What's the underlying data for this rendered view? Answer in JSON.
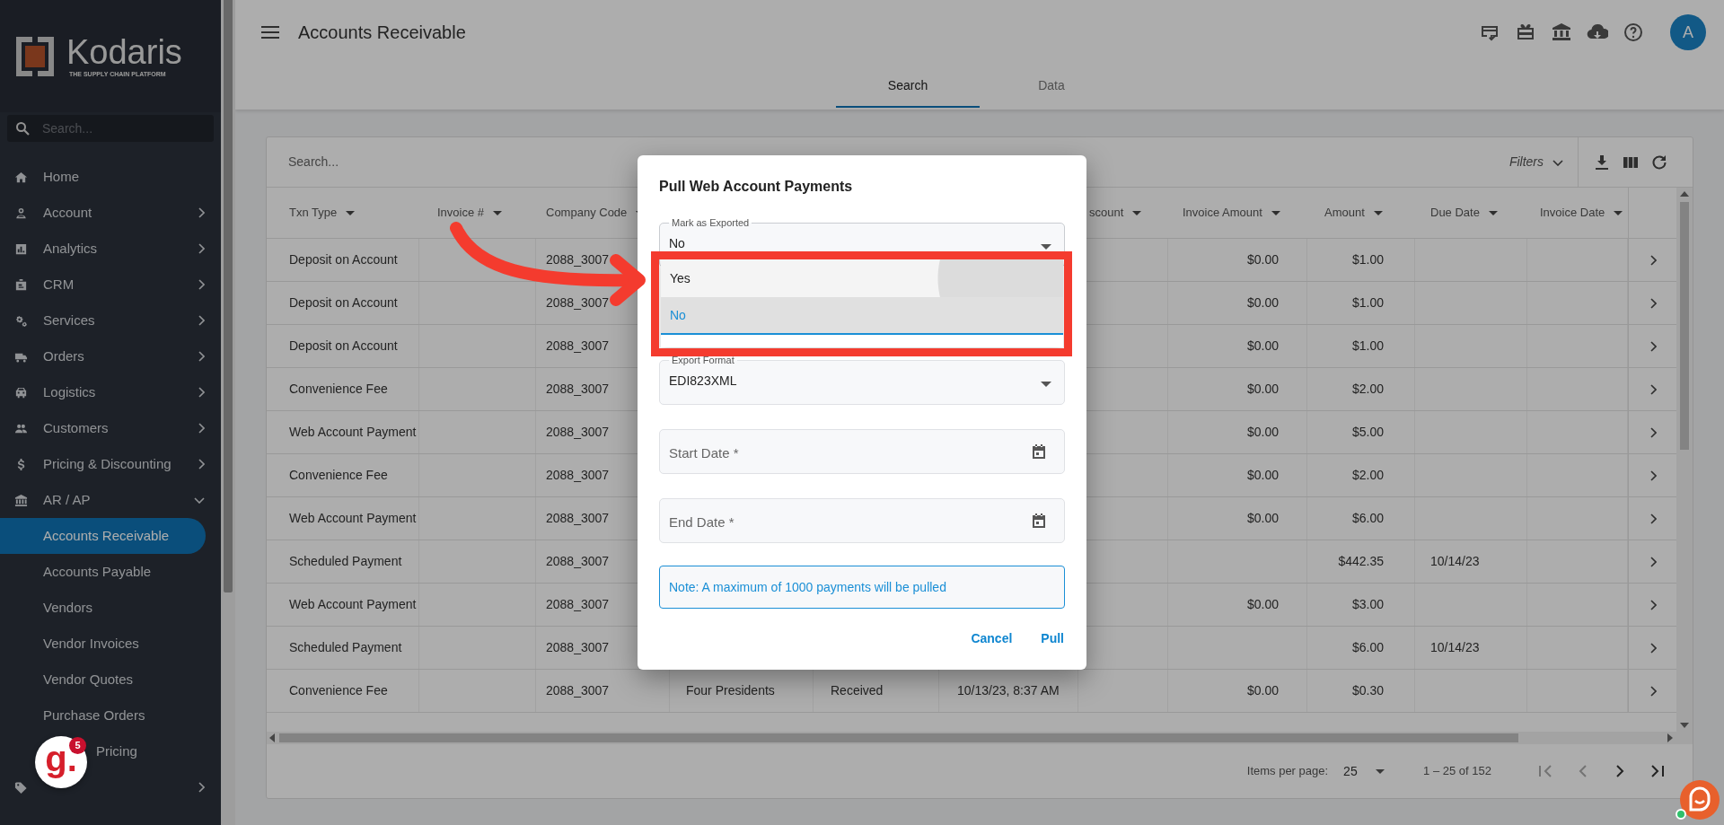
{
  "sidebar": {
    "logo": {
      "name": "Kodaris",
      "tagline": "THE SUPPLY CHAIN PLATFORM"
    },
    "search_placeholder": "Search...",
    "items": [
      {
        "label": "Home",
        "kind": "link"
      },
      {
        "label": "Account",
        "kind": "group",
        "expanded": false
      },
      {
        "label": "Analytics",
        "kind": "group",
        "expanded": false
      },
      {
        "label": "CRM",
        "kind": "group",
        "expanded": false
      },
      {
        "label": "Services",
        "kind": "group",
        "expanded": false
      },
      {
        "label": "Orders",
        "kind": "group",
        "expanded": false
      },
      {
        "label": "Logistics",
        "kind": "group",
        "expanded": false
      },
      {
        "label": "Customers",
        "kind": "group",
        "expanded": false
      },
      {
        "label": "Pricing & Discounting",
        "kind": "group",
        "expanded": false
      },
      {
        "label": "AR / AP",
        "kind": "group",
        "expanded": true,
        "children": [
          {
            "label": "Accounts Receivable",
            "selected": true
          },
          {
            "label": "Accounts Payable",
            "selected": false
          },
          {
            "label": "Vendors",
            "selected": false
          },
          {
            "label": "Vendor Invoices",
            "selected": false
          },
          {
            "label": "Vendor Quotes",
            "selected": false
          },
          {
            "label": "Purchase Orders",
            "selected": false
          },
          {
            "label": "Pricing",
            "selected": false,
            "partly_hidden": true
          }
        ]
      },
      {
        "kind": "group",
        "expanded": false
      }
    ]
  },
  "header": {
    "title": "Accounts Receivable",
    "avatar_initial": "A"
  },
  "tabs": [
    {
      "label": "Search",
      "selected": true
    },
    {
      "label": "Data",
      "selected": false
    }
  ],
  "table": {
    "search_placeholder": "Search...",
    "filters_label": "Filters",
    "columns": [
      "Txn Type",
      "Invoice #",
      "Company Code",
      null,
      null,
      null,
      "scount",
      "Invoice Amount",
      "Amount",
      "Due Date",
      "Invoice Date"
    ],
    "rows": [
      {
        "cells": [
          "Deposit on Account",
          null,
          "2088_3007",
          null,
          null,
          null,
          null,
          "$0.00",
          "$1.00",
          null,
          null
        ]
      },
      {
        "cells": [
          "Deposit on Account",
          null,
          "2088_3007",
          null,
          null,
          null,
          null,
          "$0.00",
          "$1.00",
          null,
          null
        ]
      },
      {
        "cells": [
          "Deposit on Account",
          null,
          "2088_3007",
          null,
          null,
          null,
          null,
          "$0.00",
          "$1.00",
          null,
          null
        ]
      },
      {
        "cells": [
          "Convenience Fee",
          null,
          "2088_3007",
          null,
          null,
          null,
          null,
          "$0.00",
          "$2.00",
          null,
          null
        ]
      },
      {
        "cells": [
          "Web Account Payment",
          null,
          "2088_3007",
          null,
          null,
          null,
          null,
          "$0.00",
          "$5.00",
          null,
          null
        ]
      },
      {
        "cells": [
          "Convenience Fee",
          null,
          "2088_3007",
          null,
          null,
          null,
          null,
          "$0.00",
          "$2.00",
          null,
          null
        ]
      },
      {
        "cells": [
          "Web Account Payment",
          null,
          "2088_3007",
          null,
          null,
          null,
          null,
          "$0.00",
          "$6.00",
          null,
          null
        ]
      },
      {
        "cells": [
          "Scheduled Payment",
          null,
          "2088_3007",
          null,
          null,
          null,
          null,
          null,
          "$442.35",
          "10/14/23",
          null
        ]
      },
      {
        "cells": [
          "Web Account Payment",
          null,
          "2088_3007",
          null,
          null,
          null,
          null,
          "$0.00",
          "$3.00",
          null,
          null
        ]
      },
      {
        "cells": [
          "Scheduled Payment",
          null,
          "2088_3007",
          null,
          null,
          null,
          null,
          null,
          "$6.00",
          "10/14/23",
          null
        ]
      },
      {
        "cells": [
          "Convenience Fee",
          null,
          "2088_3007",
          "Four Presidents",
          "Received",
          "10/13/23, 8:37 AM",
          null,
          "$0.00",
          "$0.30",
          null,
          null
        ]
      }
    ],
    "paginator": {
      "items_per_page_label": "Items per page:",
      "page_size": "25",
      "range": "1 – 25 of 152"
    }
  },
  "dialog": {
    "title": "Pull Web Account Payments",
    "fields": [
      {
        "kind": "select",
        "label": "Mark as Exported",
        "value": "No",
        "expanded": true,
        "options": [
          {
            "label": "Yes",
            "selected": false
          },
          {
            "label": "No",
            "selected": true
          }
        ]
      },
      {
        "kind": "select",
        "label": "Export Format",
        "value": "EDI823XML",
        "expanded": false
      },
      {
        "kind": "date",
        "placeholder": "Start Date *"
      },
      {
        "kind": "date",
        "placeholder": "End Date *"
      }
    ],
    "note": "Note: A maximum of 1000 payments will be pulled",
    "buttons": [
      {
        "label": "Cancel"
      },
      {
        "label": "Pull"
      }
    ]
  },
  "help_widget": {
    "label": "g.",
    "badge": "5"
  }
}
